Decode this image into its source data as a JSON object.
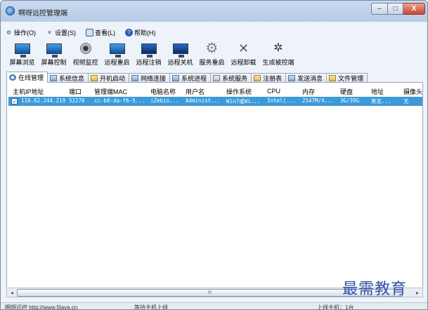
{
  "window": {
    "title": "啊呀远控管理端"
  },
  "title_buttons": {
    "minimize": "–",
    "maximize": "□",
    "close": "X"
  },
  "menu": [
    {
      "label": "操作(O)",
      "icon": "gear-icon"
    },
    {
      "label": "设置(S)",
      "icon": "tools-icon"
    },
    {
      "label": "查看(L)",
      "icon": "view-icon"
    },
    {
      "label": "帮助(H)",
      "icon": "help-icon"
    }
  ],
  "toolbar": [
    {
      "label": "屏幕浏览",
      "icon": "monitor-icon"
    },
    {
      "label": "屏幕控制",
      "icon": "monitor-control-icon"
    },
    {
      "label": "视频监控",
      "icon": "webcam-icon"
    },
    {
      "label": "远程重启",
      "icon": "restart-icon"
    },
    {
      "label": "远程注销",
      "icon": "logoff-icon"
    },
    {
      "label": "远程关机",
      "icon": "shutdown-icon"
    },
    {
      "label": "服务重启",
      "icon": "service-gear-icon"
    },
    {
      "label": "远程卸载",
      "icon": "uninstall-tools-icon"
    },
    {
      "label": "生成被控端",
      "icon": "build-client-icon"
    }
  ],
  "tabs": [
    {
      "label": "在线管理",
      "active": true
    },
    {
      "label": "系统信息",
      "active": false
    },
    {
      "label": "开机启动",
      "active": false
    },
    {
      "label": "网络连接",
      "active": false
    },
    {
      "label": "系统进程",
      "active": false
    },
    {
      "label": "系统服务",
      "active": false
    },
    {
      "label": "注册表",
      "active": false
    },
    {
      "label": "发送消息",
      "active": false
    },
    {
      "label": "文件管理",
      "active": false
    }
  ],
  "table": {
    "columns": [
      "主机IP地址",
      "端口",
      "管理端MAC",
      "电脑名称",
      "用户名",
      "操作系统",
      "CPU",
      "内存",
      "硬盘",
      "地址",
      "摄像头"
    ],
    "rows": [
      [
        "116.62.244.219",
        "52270",
        "cc-b0-da-f6-5...",
        "iZebio...",
        "Administ...",
        "Win7或Wi...",
        "Intel(...",
        "2547M/4...",
        "3G/39G",
        "黑龙...",
        "无"
      ]
    ]
  },
  "scrollbar": {
    "left_arrow": "◂",
    "right_arrow": "▸",
    "grip": "III"
  },
  "status": {
    "left": "啊呀远控 http://www.5lava.cn",
    "middle": "等待主机上线",
    "right": "上线主机：1台"
  },
  "watermark": "最需教育"
}
